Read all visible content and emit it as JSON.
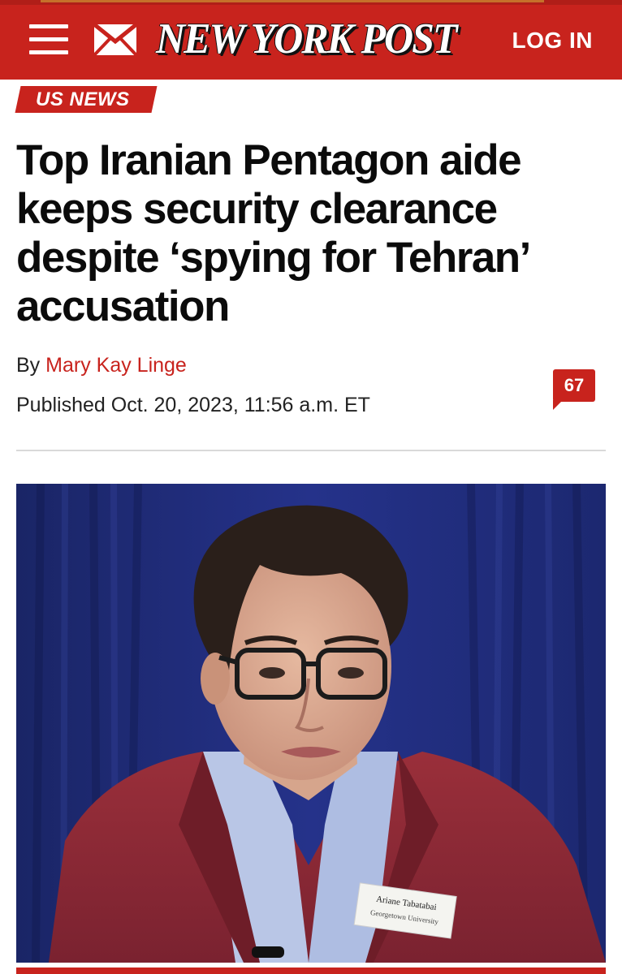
{
  "header": {
    "logo_text": "NEW YORK POST",
    "login_label": "LOG IN",
    "menu_icon": "hamburger-menu-icon",
    "mail_icon": "envelope-icon",
    "brand_color": "#c8231d"
  },
  "article": {
    "category": "US NEWS",
    "headline": "Top Iranian Pentagon aide keeps security clearance despite ‘spying for Tehran’ accusation",
    "byline_prefix": "By",
    "author": "Mary Kay Linge",
    "published": "Published Oct. 20, 2023, 11:56 a.m. ET",
    "comment_count": "67"
  },
  "photo": {
    "name_tag_line1": "Ariane Tabatabai",
    "name_tag_line2": "Georgetown University"
  }
}
